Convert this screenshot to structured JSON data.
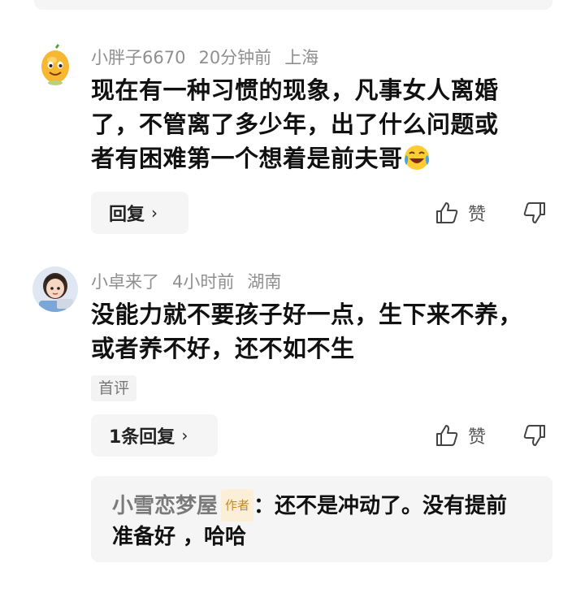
{
  "comments": [
    {
      "username": "小胖子6670",
      "time": "20分钟前",
      "location": "上海",
      "text_line1": "现在有一种习惯的现象，凡事女人离婚",
      "text_line2": "了，不管离了多少年，出了什么问题或",
      "text_line3": "者有困难第一个想着是前夫哥",
      "emoji": "laughing-crying-emoji",
      "reply_label": "回复",
      "like_label": "赞"
    },
    {
      "username": "小卓来了",
      "time": "4小时前",
      "location": "湖南",
      "text_line1": "没能力就不要孩子好一点，生下来不养，",
      "text_line2": "或者养不好，还不如不生",
      "tag": "首评",
      "reply_label": "1条回复",
      "like_label": "赞"
    }
  ],
  "reply_preview": {
    "author": "小雪恋梦屋",
    "badge": "作者",
    "separator": "：",
    "text_part1": "还不是冲动了。没有提前",
    "text_part2": "准备好 ，哈哈"
  },
  "colors": {
    "meta_gray": "#8f8f8f",
    "button_bg": "#f5f5f5",
    "badge_text": "#c28a2a",
    "badge_bg": "#fbefd8"
  }
}
